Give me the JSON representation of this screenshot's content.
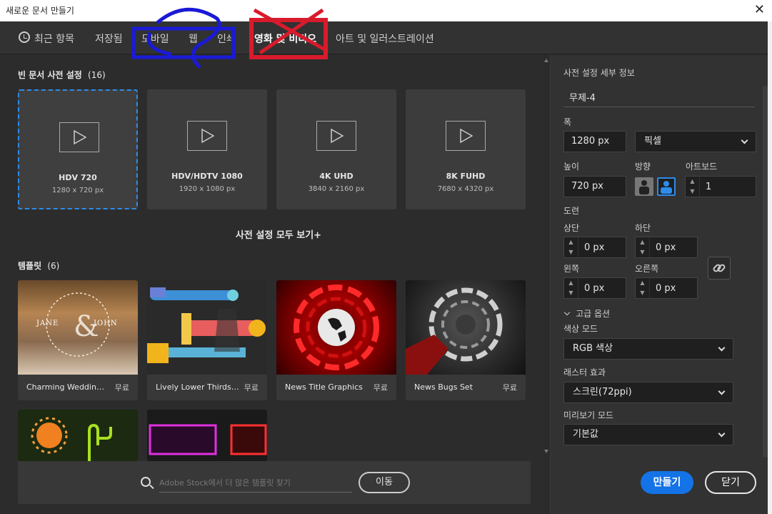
{
  "window": {
    "title": "새로운 문서 만들기",
    "close": "✕"
  },
  "tabs": [
    {
      "label": "최근 항목"
    },
    {
      "label": "저장됨"
    },
    {
      "label": "모바일"
    },
    {
      "label": "웹"
    },
    {
      "label": "인쇄"
    },
    {
      "label": "영화 및 비디오"
    },
    {
      "label": "아트 및 일러스트레이션"
    }
  ],
  "presets": {
    "heading": "빈 문서 사전 설정",
    "count": "(16)",
    "items": [
      {
        "name": "HDV 720",
        "dims": "1280 x 720 px"
      },
      {
        "name": "HDV/HDTV 1080",
        "dims": "1920 x 1080 px"
      },
      {
        "name": "4K UHD",
        "dims": "3840 x 2160 px"
      },
      {
        "name": "8K FUHD",
        "dims": "7680 x 4320 px"
      }
    ],
    "view_all": "사전 설정 모두 보기+"
  },
  "templates": {
    "heading": "템플릿",
    "count": "(6)",
    "items": [
      {
        "name": "Charming Wedding T...",
        "price": "무료",
        "overlay1": "JANE",
        "overlay2": "JOHN"
      },
      {
        "name": "Lively Lower Thirds Set",
        "price": "무료"
      },
      {
        "name": "News Title Graphics",
        "price": "무료"
      },
      {
        "name": "News Bugs Set",
        "price": "무료"
      }
    ]
  },
  "search": {
    "placeholder": "Adobe Stock에서 더 많은 템플릿 찾기",
    "go": "이동"
  },
  "details": {
    "heading": "사전 설정 세부 정보",
    "doc_name": "무제-4",
    "width_label": "폭",
    "width_value": "1280 px",
    "unit": "픽셀",
    "height_label": "높이",
    "height_value": "720 px",
    "orientation_label": "방향",
    "artboard_label": "아트보드",
    "artboard_value": "1",
    "bleed_label": "도련",
    "top_label": "상단",
    "top_value": "0 px",
    "bottom_label": "하단",
    "bottom_value": "0 px",
    "left_label": "왼쪽",
    "left_value": "0 px",
    "right_label": "오른쪽",
    "right_value": "0 px",
    "advanced": "고급 옵션",
    "color_mode_label": "색상 모드",
    "color_mode": "RGB 색상",
    "raster_label": "래스터 효과",
    "raster": "스크린(72ppi)",
    "preview_label": "미리보기 모드",
    "preview": "기본값"
  },
  "actions": {
    "create": "만들기",
    "close": "닫기"
  },
  "colors": {
    "accent": "#1473e6",
    "selected_border": "#2d8ceb",
    "annot_blue": "#1a1acf",
    "annot_red": "#d81b2c"
  }
}
